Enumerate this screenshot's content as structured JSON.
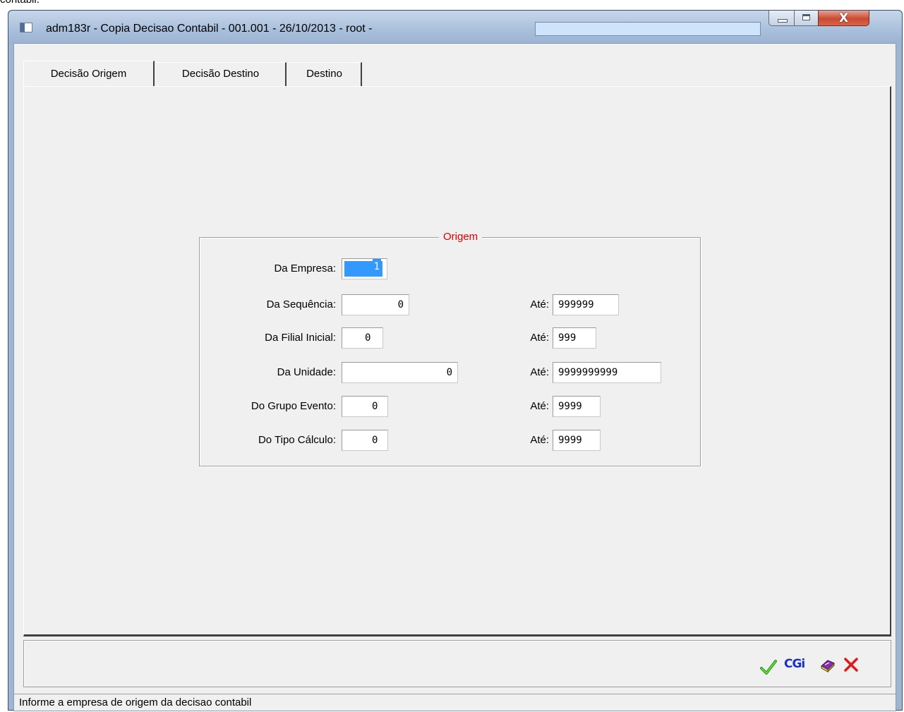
{
  "window": {
    "title": "adm183r - Copia Decisao Contabil - 001.001 - 26/10/2013 - root -",
    "close_glyph": "X"
  },
  "top_cut_text": "contabil.",
  "tabs": [
    {
      "label": "Decisão Origem",
      "active": true
    },
    {
      "label": "Decisão Destino",
      "active": false
    },
    {
      "label": "Destino",
      "active": false
    }
  ],
  "group": {
    "title": "Origem",
    "title_color": "#e00000"
  },
  "form": {
    "empresa": {
      "label": "Da Empresa:",
      "value": "1"
    },
    "sequencia": {
      "label": "Da Sequência:",
      "value": "0",
      "ate_label": "Até:",
      "ate_value": "999999"
    },
    "filial": {
      "label": "Da Filial Inicial:",
      "value": "0",
      "ate_label": "Até:",
      "ate_value": "999"
    },
    "unidade": {
      "label": "Da Unidade:",
      "value": "0",
      "ate_label": "Até:",
      "ate_value": "9999999999"
    },
    "grupo_evento": {
      "label": "Do Grupo Evento:",
      "value": "0",
      "ate_label": "Até:",
      "ate_value": "9999"
    },
    "tipo_calculo": {
      "label": "Do Tipo Cálculo:",
      "value": "0",
      "ate_label": "Até:",
      "ate_value": "9999"
    }
  },
  "toolbar": {
    "ok_icon": "checkmark-icon",
    "cgi_label": "CGi",
    "help_icon": "help-book-icon",
    "cancel_icon": "close-icon"
  },
  "status": {
    "text": "Informe a empresa de origem da decisao contabil"
  }
}
